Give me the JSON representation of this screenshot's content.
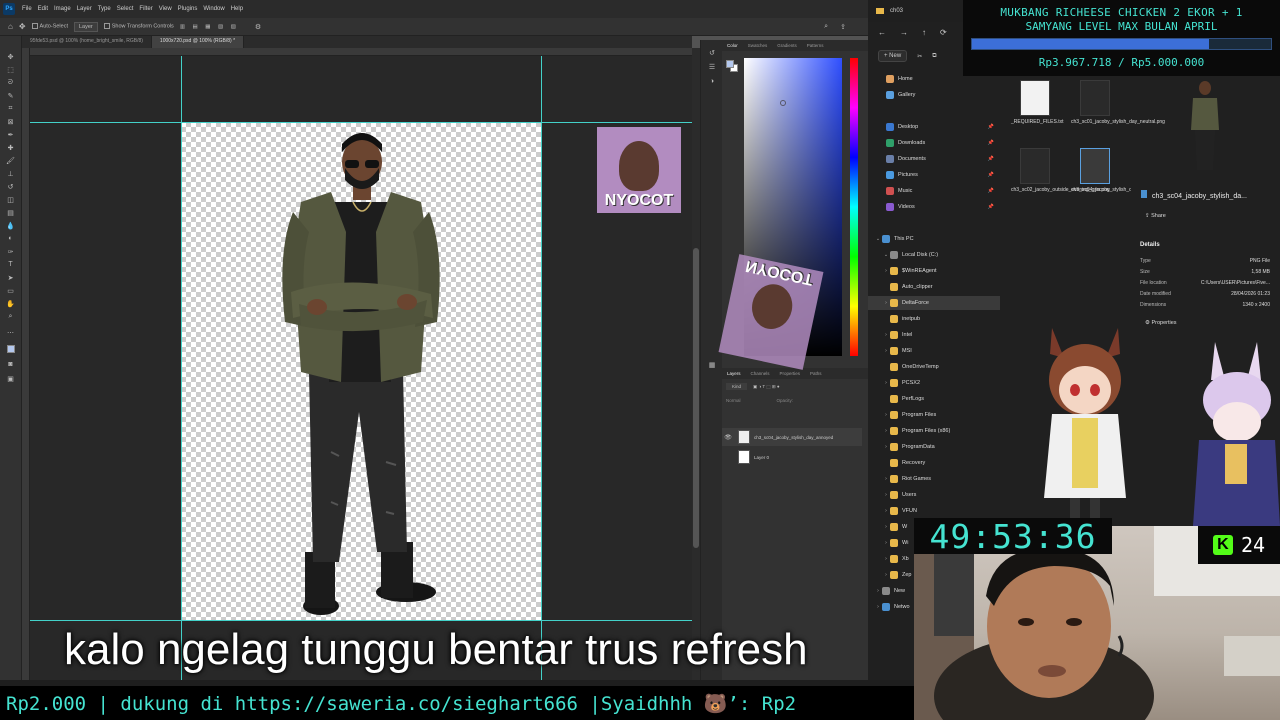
{
  "photoshop": {
    "app_icon": "Ps",
    "menu": [
      "File",
      "Edit",
      "Image",
      "Layer",
      "Type",
      "Select",
      "Filter",
      "View",
      "Plugins",
      "Window",
      "Help"
    ],
    "options": {
      "auto_select": "Auto-Select",
      "layer_dropdown": "Layer",
      "show_transform": "Show Transform Controls"
    },
    "tabs": [
      "95fde53.psd @ 100% (home_bright_smile, RGB/8)",
      "1000x720.psd @ 100% (RGB/8) *"
    ],
    "color_panel_tabs": [
      "Color",
      "Swatches",
      "Gradients",
      "Patterns"
    ],
    "layers_panel_tabs": [
      "Layers",
      "Channels",
      "Properties",
      "Paths"
    ],
    "layer_filter": "Kind",
    "blend_mode": "Normal",
    "opacity_label": "Opacity:",
    "layers": [
      {
        "name": "ch3_sc04_jacoby_stylish_day_annoyed"
      },
      {
        "name": "Layer 0"
      }
    ]
  },
  "stickers": {
    "nyocot": "NYOCOT",
    "nyocot_flipped": "NYOCOT"
  },
  "explorer": {
    "window_title": "ch03",
    "new_button": "New",
    "sidebar": [
      {
        "label": "Home",
        "icon": "home-icon"
      },
      {
        "label": "Gallery",
        "icon": "gallery-icon"
      },
      {
        "label": "Desktop",
        "icon": "desktop-icon"
      },
      {
        "label": "Downloads",
        "icon": "downloads-icon"
      },
      {
        "label": "Documents",
        "icon": "documents-icon"
      },
      {
        "label": "Pictures",
        "icon": "pictures-icon"
      },
      {
        "label": "Music",
        "icon": "music-icon"
      },
      {
        "label": "Videos",
        "icon": "videos-icon"
      }
    ],
    "tree": [
      {
        "label": "This PC"
      },
      {
        "label": "Local Disk (C:)"
      },
      {
        "label": "$WinREAgent"
      },
      {
        "label": "Auto_clipper"
      },
      {
        "label": "DeltaForce"
      },
      {
        "label": "inetpub"
      },
      {
        "label": "Intel"
      },
      {
        "label": "MSI"
      },
      {
        "label": "OneDriveTemp"
      },
      {
        "label": "PCSX2"
      },
      {
        "label": "PerfLogs"
      },
      {
        "label": "Program Files"
      },
      {
        "label": "Program Files (x86)"
      },
      {
        "label": "ProgramData"
      },
      {
        "label": "Recovery"
      },
      {
        "label": "Riot Games"
      },
      {
        "label": "Users"
      },
      {
        "label": "VFUN"
      },
      {
        "label": "W"
      },
      {
        "label": "Wi"
      },
      {
        "label": "Xb"
      },
      {
        "label": "Zep"
      },
      {
        "label": "New"
      },
      {
        "label": "Netwo"
      }
    ],
    "files": [
      {
        "name": "_REQUIRED_FILES.txt"
      },
      {
        "name": "ch3_sc01_jacoby_stylish_day_neutral.png"
      },
      {
        "name": "ch3_sc02_jacoby_outside_evening_grin.png"
      },
      {
        "name": "ch3_sc04_jacoby_stylish_day_annoyed.png"
      }
    ],
    "details": {
      "filename": "ch3_sc04_jacoby_stylish_da...",
      "share": "Share",
      "title": "Details",
      "rows": [
        {
          "k": "Type",
          "v": "PNG File"
        },
        {
          "k": "Size",
          "v": "1,58 MB"
        },
        {
          "k": "File location",
          "v": "C:\\Users\\USER\\Pictures\\Five..."
        },
        {
          "k": "Date modified",
          "v": "28/04/2026 01:23"
        },
        {
          "k": "Dimensions",
          "v": "1340 x 2400"
        }
      ],
      "properties": "Properties"
    }
  },
  "stream": {
    "goal": {
      "title_line1": "MUKBANG RICHEESE CHICKEN 2 EKOR + 1",
      "title_line2": "SAMYANG LEVEL MAX BULAN APRIL",
      "amount": "Rp3.967.718 / Rp5.000.000",
      "progress": 0.7935
    },
    "timer": "49:53:36",
    "kick_logo": "K",
    "viewers": "24",
    "caption": "kalo ngelag tunggu bentar trus refresh",
    "ticker": "Rp2.000 |  dukung di https://saweria.co/sieghart666 |Syaidhhh 🐻’: Rp2"
  }
}
